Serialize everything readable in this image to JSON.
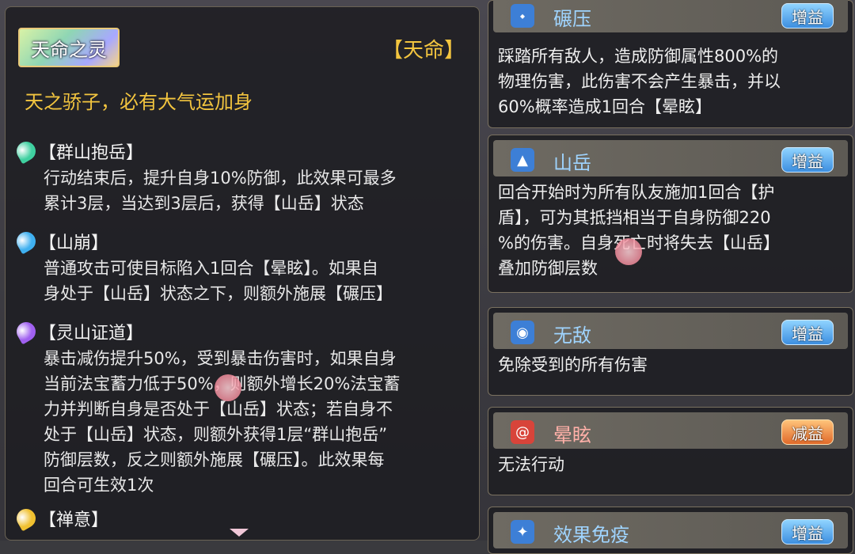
{
  "left": {
    "fate_badge": "天命之灵",
    "fate_tag": "【天命】",
    "fate_desc": "天之骄子，必有大气运加身",
    "skills": [
      {
        "title": "【群山抱岳】",
        "orb_color": "#3fd0a0",
        "lines": [
          "行动结束后，提升自身10%防御，此效果可最多",
          "累计3层，当达到3层后，获得【山岳】状态"
        ]
      },
      {
        "title": "【山崩】",
        "orb_color": "#3fb0f0",
        "lines": [
          "普通攻击可使目标陷入1回合【晕眩】。如果自",
          "身处于【山岳】状态之下，则额外施展【碾压】"
        ]
      },
      {
        "title": "【灵山证道】",
        "orb_color": "#a060f0",
        "lines": [
          "暴击减伤提升50%，受到暴击伤害时，如果自身",
          "当前法宝蓄力低于50%，则额外增长20%法宝蓄",
          "力并判断自身是否处于【山岳】状态；若自身不",
          "处于【山岳】状态，则额外获得1层“群山抱岳”",
          "防御层数，反之则额外施展【碾压】。此效果每",
          "回合可生效1次"
        ]
      },
      {
        "title": "【禅意】",
        "orb_color": "#f0c030",
        "lines": []
      }
    ]
  },
  "right": {
    "cards": [
      {
        "name": "碾压",
        "icon": "foot-icon",
        "icon_color": "#3d7fd6",
        "badge": "增益",
        "lines": [
          "踩踏所有敌人，造成防御属性800%的",
          "物理伤害，此伤害不会产生暴击，并以",
          "60%概率造成1回合【晕眩】"
        ]
      },
      {
        "name": "山岳",
        "icon": "mountain-icon",
        "icon_color": "#3d7fd6",
        "badge": "增益",
        "lines": [
          "回合开始时为所有队友施加1回合【护",
          "盾】，可为其抵挡相当于自身防御220",
          "%的伤害。自身死亡时将失去【山岳】",
          "叠加防御层数"
        ]
      },
      {
        "name": "无敌",
        "icon": "shield-icon",
        "icon_color": "#3d7fd6",
        "badge": "增益",
        "lines": [
          "免除受到的所有伤害"
        ]
      },
      {
        "name": "晕眩",
        "icon": "swirl-icon",
        "icon_color": "#d8443a",
        "badge": "减益",
        "lines": [
          "无法行动"
        ]
      },
      {
        "name": "效果免疫",
        "icon": "wing-icon",
        "icon_color": "#3d7fd6",
        "badge": "增益",
        "lines": []
      }
    ]
  }
}
